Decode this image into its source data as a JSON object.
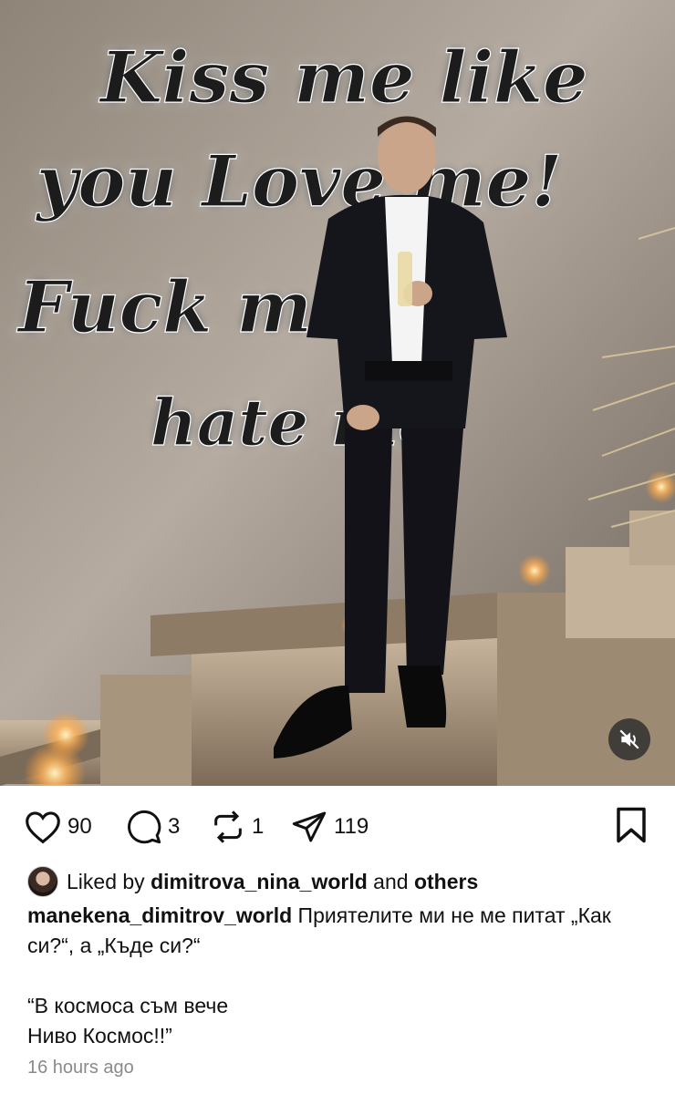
{
  "post": {
    "media": {
      "neon_sign_lines": [
        "Kiss me like",
        "you Love me!",
        "Fuck me",
        "hate me"
      ],
      "mute_icon": "speaker-muted-icon"
    },
    "actions": {
      "like": {
        "icon": "heart-icon",
        "count": "90"
      },
      "comment": {
        "icon": "comment-icon",
        "count": "3"
      },
      "repost": {
        "icon": "repost-icon",
        "count": "1"
      },
      "share": {
        "icon": "send-icon",
        "count": "119"
      },
      "save": {
        "icon": "bookmark-icon"
      }
    },
    "likes": {
      "prefix": "Liked by",
      "user": "dimitrova_nina_world",
      "joiner": "and",
      "others": "others"
    },
    "caption": {
      "username": "manekena_dimitrov_world",
      "text": "Приятелите ми не ме питат „Как си?“, а „Къде си?“\n\n“В космоса съм вече\nНиво Космос!!”"
    },
    "timestamp": "16 hours ago"
  }
}
